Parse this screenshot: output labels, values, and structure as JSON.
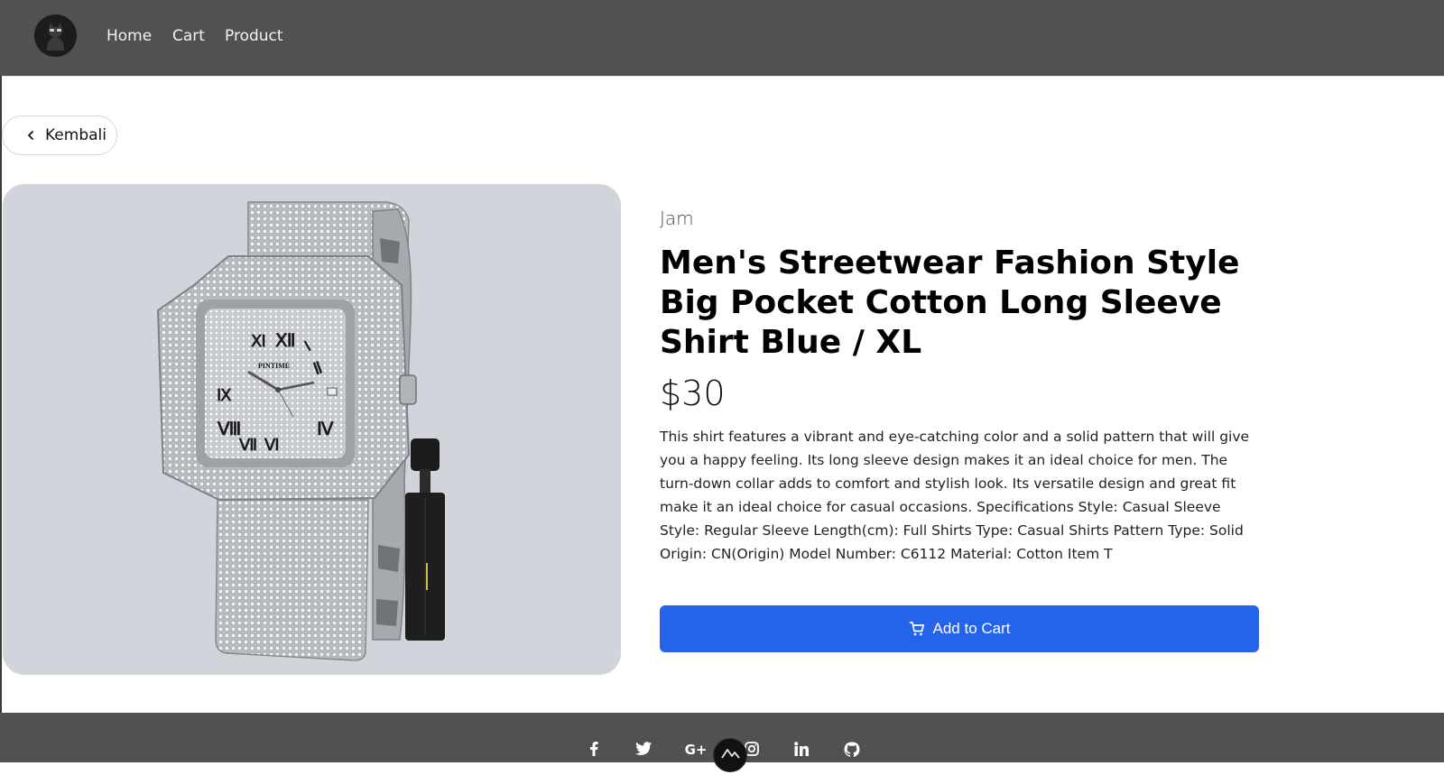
{
  "nav": {
    "links": [
      "Home",
      "Cart",
      "Product"
    ]
  },
  "back": {
    "label": "Kembali"
  },
  "product": {
    "category": "Jam",
    "title": "Men's Streetwear Fashion Style Big Pocket Cotton Long Sleeve Shirt Blue / XL",
    "price": "$30",
    "description": "This shirt features a vibrant and eye-catching color and a solid pattern that will give you a happy feeling. Its long sleeve design makes it an ideal choice for men. The turn-down collar adds to comfort and stylish look. Its versatile design and great fit make it an ideal choice for casual occasions. Specifications Style: Casual Sleeve Style: Regular Sleeve Length(cm): Full Shirts Type: Casual Shirts Pattern Type: Solid Origin: CN(Origin) Model Number: C6112 Material: Cotton Item T",
    "add_to_cart_label": "Add to Cart",
    "image_alt_icon": "watch-image"
  },
  "footer": {
    "social_icons": [
      "facebook-icon",
      "twitter-icon",
      "google-plus-icon",
      "instagram-icon",
      "linkedin-icon",
      "github-icon"
    ]
  },
  "colors": {
    "navbar": "#515151",
    "accent": "#2563eb",
    "image_bg": "#d1d5db"
  }
}
